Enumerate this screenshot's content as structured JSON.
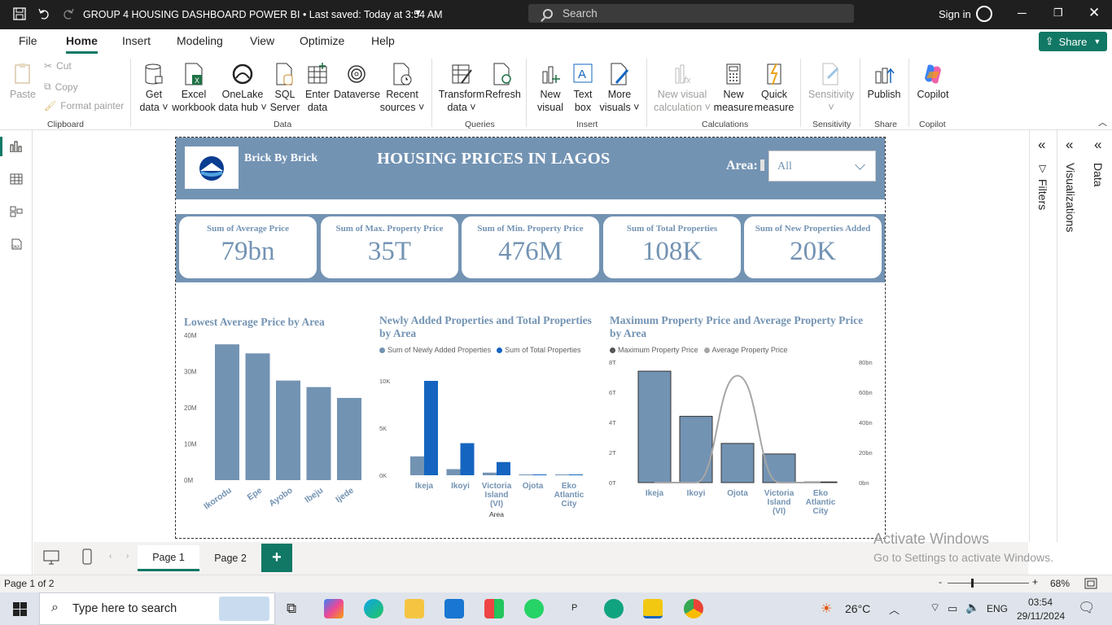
{
  "titlebar": {
    "title": "GROUP 4 HOUSING DASHBOARD POWER BI • Last saved: Today at 3:54 AM",
    "search_placeholder": "Search",
    "sign_in": "Sign in"
  },
  "menu": {
    "items": [
      "File",
      "Home",
      "Insert",
      "Modeling",
      "View",
      "Optimize",
      "Help"
    ],
    "active": "Home",
    "share": "Share"
  },
  "ribbon": {
    "clipboard": {
      "paste": "Paste",
      "cut": "Cut",
      "copy": "Copy",
      "format_painter": "Format painter",
      "label": "Clipboard"
    },
    "data": {
      "get_data": [
        "Get",
        "data ˅"
      ],
      "excel": [
        "Excel",
        "workbook"
      ],
      "onelake": [
        "OneLake",
        "data hub ˅"
      ],
      "sql": [
        "SQL",
        "Server"
      ],
      "enter": [
        "Enter",
        "data"
      ],
      "dataverse": [
        "Dataverse",
        ""
      ],
      "recent": [
        "Recent",
        "sources ˅"
      ],
      "label": "Data"
    },
    "queries": {
      "transform": [
        "Transform",
        "data ˅"
      ],
      "refresh": [
        "Refresh",
        ""
      ],
      "label": "Queries"
    },
    "insert": {
      "new_visual": [
        "New",
        "visual"
      ],
      "text_box": [
        "Text",
        "box"
      ],
      "more_visuals": [
        "More",
        "visuals ˅"
      ],
      "label": "Insert"
    },
    "calculations": {
      "new_visual_calc": [
        "New visual",
        "calculation ˅"
      ],
      "new_measure": [
        "New",
        "measure"
      ],
      "quick_measure": [
        "Quick",
        "measure"
      ],
      "label": "Calculations"
    },
    "sensitivity": {
      "btn": [
        "Sensitivity",
        "˅"
      ],
      "label": "Sensitivity"
    },
    "share": {
      "publish": "Publish",
      "label": "Share"
    },
    "copilot": {
      "btn": "Copilot",
      "label": "Copilot"
    }
  },
  "report": {
    "brand": "Brick By Brick",
    "title": "HOUSING PRICES IN LAGOS",
    "area_label": "Area:",
    "area_value": "All",
    "kpis": [
      {
        "label": "Sum of Average Price",
        "value": "79bn"
      },
      {
        "label": "Sum of Max. Property Price",
        "value": "35T"
      },
      {
        "label": "Sum of Min. Property Price",
        "value": "476M"
      },
      {
        "label": "Sum of Total Properties",
        "value": "108K"
      },
      {
        "label": "Sum of New Properties Added",
        "value": "20K"
      }
    ]
  },
  "chart_data": [
    {
      "type": "bar",
      "title": "Lowest Average Price by Area",
      "categories": [
        "Ikorodu",
        "Epe",
        "Ayobo",
        "Ibeju",
        "Ijede"
      ],
      "values": [
        37500000,
        35000000,
        27500000,
        25700000,
        22700000
      ],
      "ylim": [
        0,
        40000000
      ],
      "yticks": [
        "0M",
        "10M",
        "20M",
        "30M",
        "40M"
      ],
      "color": "#7393b3"
    },
    {
      "type": "bar",
      "title": "Newly Added Properties and Total Properties by Area",
      "categories": [
        "Ikeja",
        "Ikoyi",
        "Victoria Island (VI)",
        "Ojota",
        "Eko Atlantic City"
      ],
      "xlabel": "Area",
      "series": [
        {
          "name": "Sum of Newly Added Properties",
          "color": "#7393b3",
          "values": [
            2000,
            650,
            280,
            60,
            60
          ]
        },
        {
          "name": "Sum of Total Properties",
          "color": "#1565c0",
          "values": [
            10000,
            3400,
            1400,
            60,
            60
          ]
        }
      ],
      "ylim": [
        0,
        11000
      ],
      "yticks": [
        "0K",
        "5K",
        "10K"
      ]
    },
    {
      "type": "bar",
      "title": "Maximum Property Price and Average Property Price by Area",
      "categories": [
        "Ikeja",
        "Ikoyi",
        "Ojota",
        "Victoria Island (VI)",
        "Eko Atlantic City"
      ],
      "series": [
        {
          "name": "Maximum Property Price",
          "color": "#7393b3",
          "values": [
            7400000000000.0,
            4400000000000.0,
            2600000000000.0,
            1900000000000.0,
            0
          ]
        },
        {
          "name": "Average Property Price",
          "color": "#a6a6a6",
          "type": "line",
          "values": [
            0,
            0,
            71000000000.0,
            0,
            0
          ]
        }
      ],
      "yticks_left": [
        "0T",
        "2T",
        "4T",
        "6T",
        "8T"
      ],
      "yticks_right": [
        "0bn",
        "20bn",
        "40bn",
        "60bn",
        "80bn"
      ]
    }
  ],
  "pages": {
    "tabs": [
      "Page 1",
      "Page 2"
    ],
    "active": "Page 1",
    "add": "+"
  },
  "panes": {
    "filters": "Filters",
    "visualizations": "Visualizations",
    "data": "Data"
  },
  "status": {
    "page": "Page 1 of 2",
    "zoom": "68%"
  },
  "watermark": {
    "line1": "Activate Windows",
    "line2": "Go to Settings to activate Windows."
  },
  "taskbar": {
    "search": "Type here to search",
    "weather": "26°C",
    "lang": "ENG",
    "time": "03:54",
    "date": "29/11/2024"
  }
}
